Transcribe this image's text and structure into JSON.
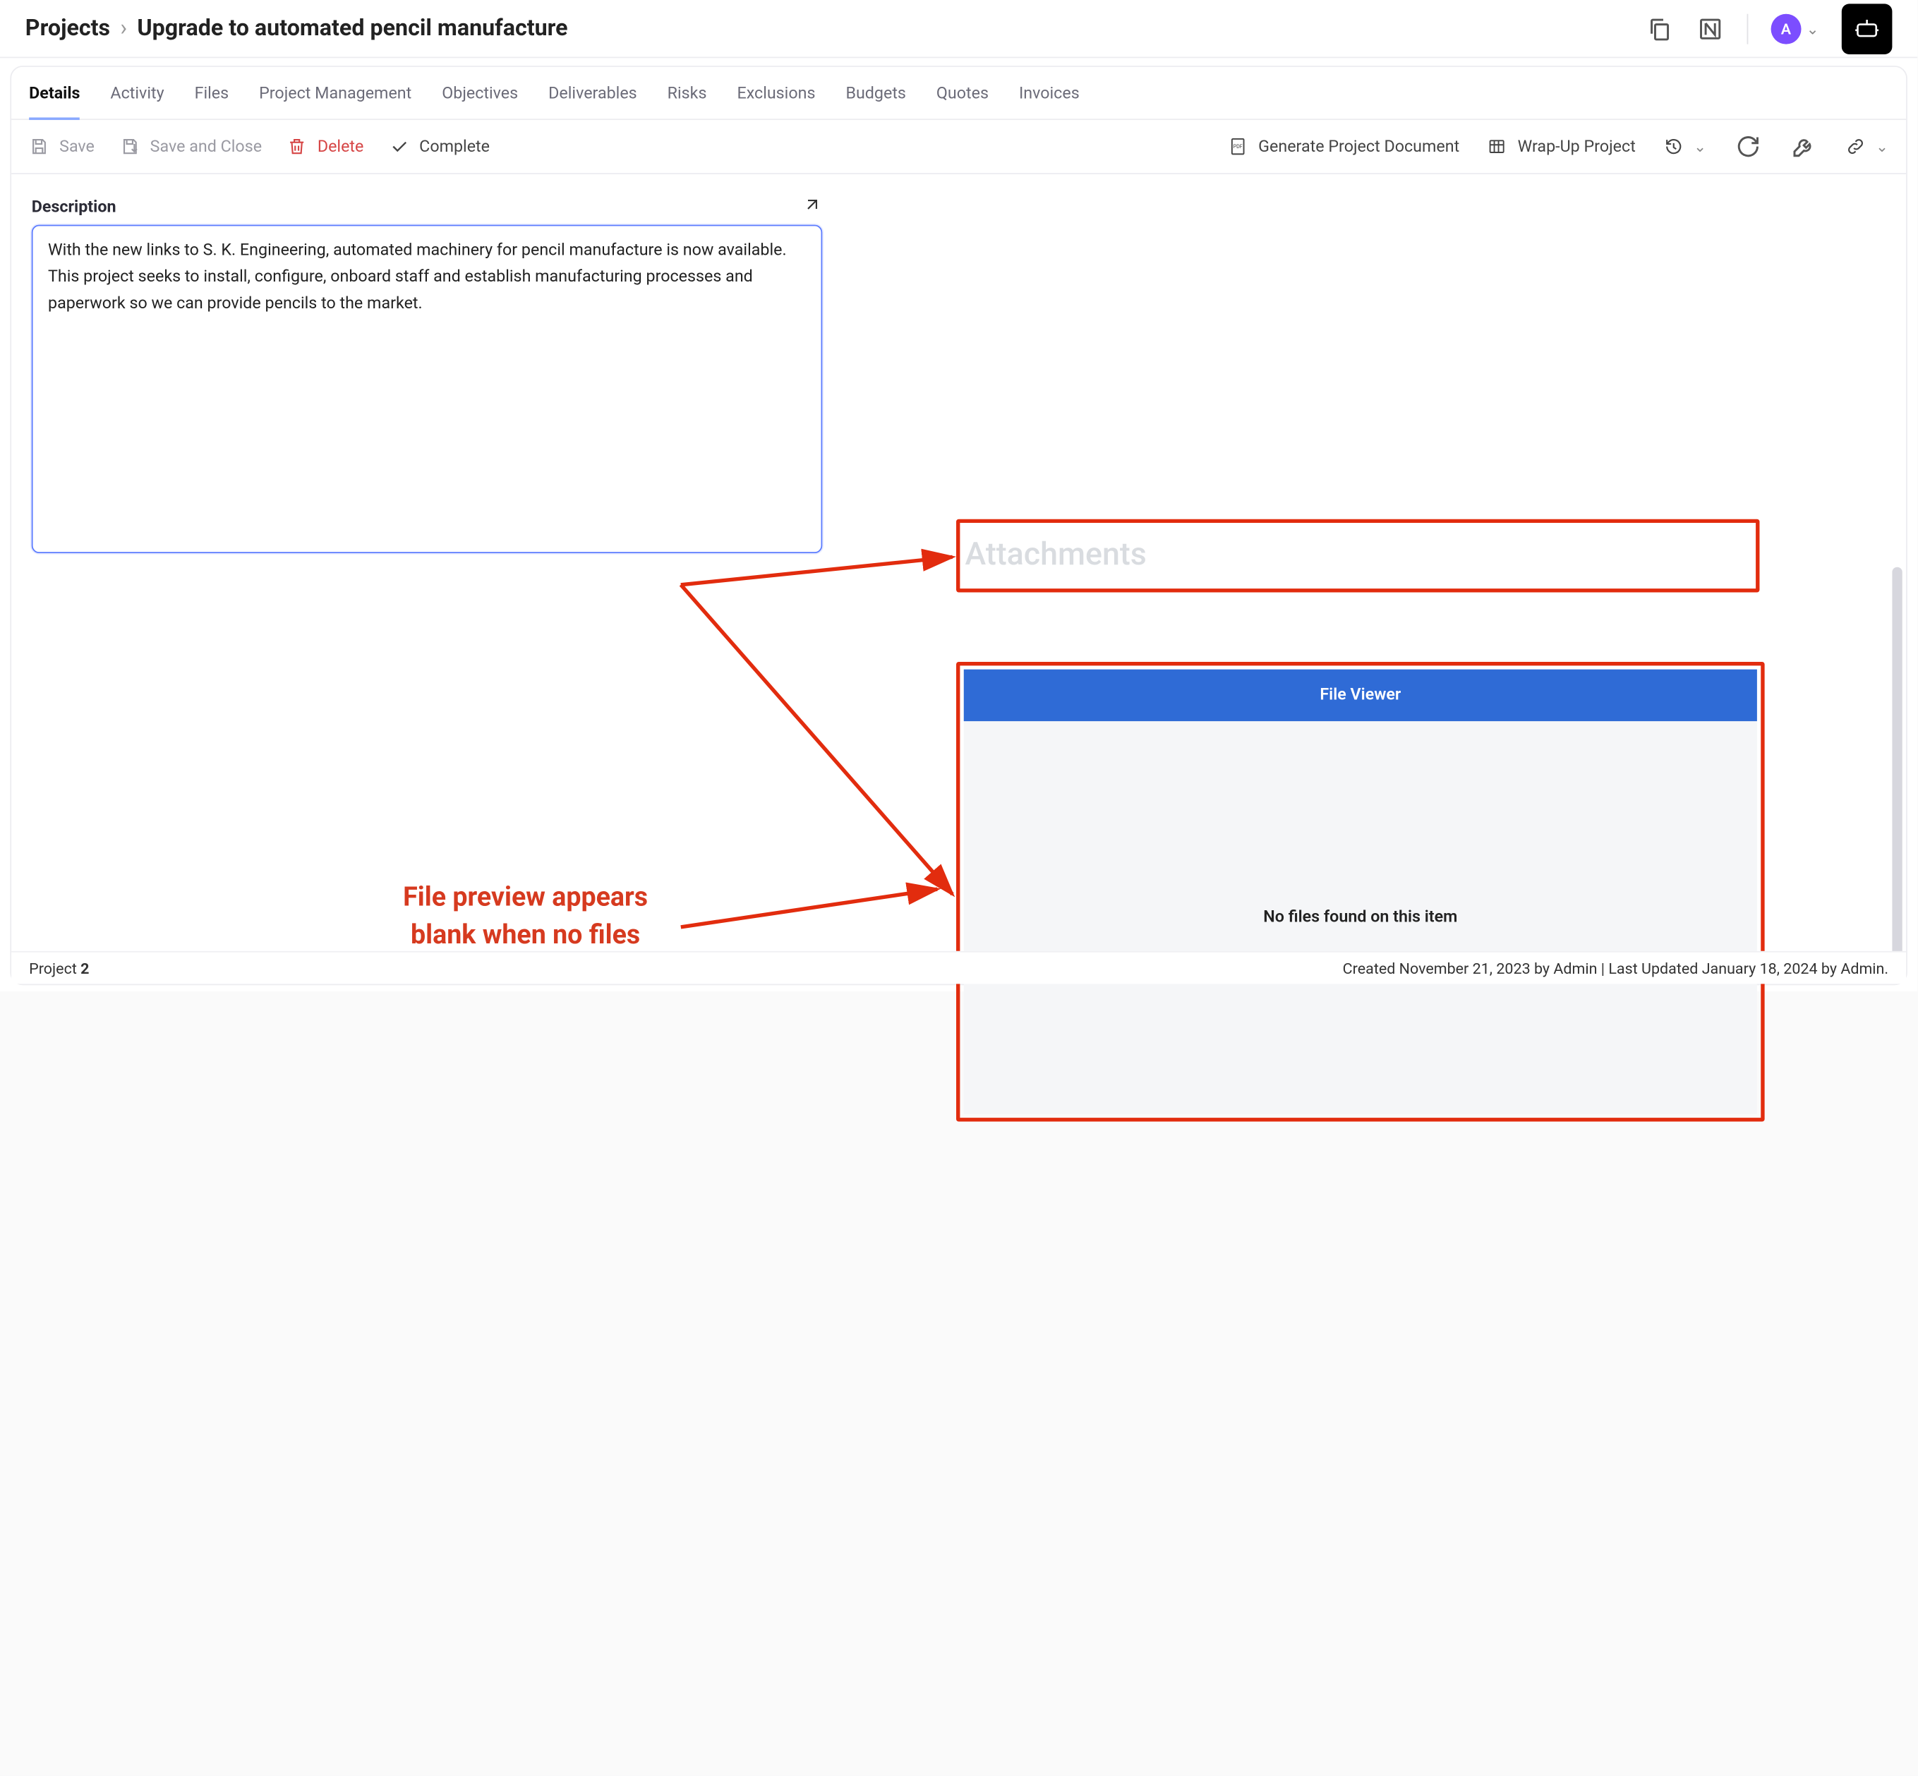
{
  "breadcrumb": {
    "root": "Projects",
    "title": "Upgrade to automated pencil manufacture"
  },
  "header": {
    "avatar_initial": "A"
  },
  "tabs": [
    "Details",
    "Activity",
    "Files",
    "Project Management",
    "Objectives",
    "Deliverables",
    "Risks",
    "Exclusions",
    "Budgets",
    "Quotes",
    "Invoices"
  ],
  "active_tab_index": 0,
  "toolbar": {
    "save": "Save",
    "save_close": "Save and Close",
    "delete": "Delete",
    "complete": "Complete",
    "gen_doc": "Generate Project Document",
    "wrap_up": "Wrap-Up Project"
  },
  "description": {
    "label": "Description",
    "text": "With the new links to S. K. Engineering, automated machinery for pencil manufacture is now available. This project seeks to install, configure, onboard staff and establish manufacturing processes and paperwork so we can provide pencils to the market."
  },
  "attachments": {
    "label": "Attachments",
    "file_viewer_header": "File Viewer",
    "empty_message": "No files found on this item"
  },
  "annotation": {
    "text": "File preview appears blank when no files attached"
  },
  "footer": {
    "project_label": "Project ",
    "project_number": "2",
    "meta": "Created November 21, 2023 by Admin | Last Updated January 18, 2024 by Admin."
  }
}
